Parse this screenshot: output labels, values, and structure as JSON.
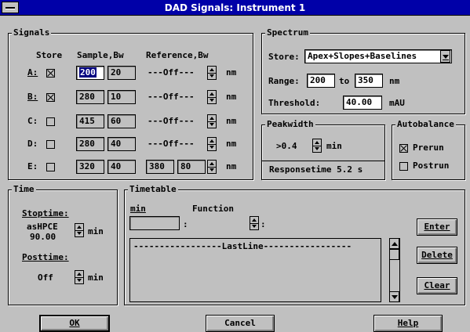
{
  "window": {
    "title": "DAD Signals: Instrument 1"
  },
  "signals": {
    "group_label": "Signals",
    "headers": {
      "store": "Store",
      "sample_bw": "Sample,Bw",
      "reference_bw": "Reference,Bw"
    },
    "unit": "nm",
    "rows": [
      {
        "key": "A:",
        "checked": true,
        "sample": "200",
        "bw": "20",
        "ref": "---Off---",
        "ref_bw": ""
      },
      {
        "key": "B:",
        "checked": true,
        "sample": "280",
        "bw": "10",
        "ref": "---Off---",
        "ref_bw": ""
      },
      {
        "key": "C:",
        "checked": false,
        "sample": "415",
        "bw": "60",
        "ref": "---Off---",
        "ref_bw": ""
      },
      {
        "key": "D:",
        "checked": false,
        "sample": "280",
        "bw": "40",
        "ref": "---Off---",
        "ref_bw": ""
      },
      {
        "key": "E:",
        "checked": false,
        "sample": "320",
        "bw": "40",
        "ref": "380",
        "ref_bw": "80"
      }
    ]
  },
  "spectrum": {
    "group_label": "Spectrum",
    "store_label": "Store:",
    "store_value": "Apex+Slopes+Baselines",
    "range_label": "Range:",
    "range_from": "200",
    "range_to_label": "to",
    "range_to": "350",
    "range_unit": "nm",
    "threshold_label": "Threshold:",
    "threshold_value": "40.00",
    "threshold_unit": "mAU"
  },
  "peakwidth": {
    "group_label": "Peakwidth",
    "value": ">0.4",
    "unit": "min",
    "responsetime": "Responsetime 5.2 s"
  },
  "autobalance": {
    "group_label": "Autobalance",
    "prerun_label": "Prerun",
    "prerun_checked": true,
    "postrun_label": "Postrun",
    "postrun_checked": false
  },
  "time": {
    "group_label": "Time",
    "stoptime_label": "Stoptime:",
    "stoptime_value_line1": "asHPCE",
    "stoptime_value_line2": "90.00",
    "stoptime_unit": "min",
    "posttime_label": "Posttime:",
    "posttime_value": "Off",
    "posttime_unit": "min"
  },
  "timetable": {
    "group_label": "Timetable",
    "min_header": "min",
    "function_header": "Function",
    "colon1": ":",
    "colon2": ":",
    "min_value": "",
    "list_line": "-----------------LastLine-----------------",
    "enter_label": "Enter",
    "delete_label": "Delete",
    "clear_label": "Clear"
  },
  "buttons": {
    "ok": "OK",
    "cancel": "Cancel",
    "help": "Help"
  }
}
